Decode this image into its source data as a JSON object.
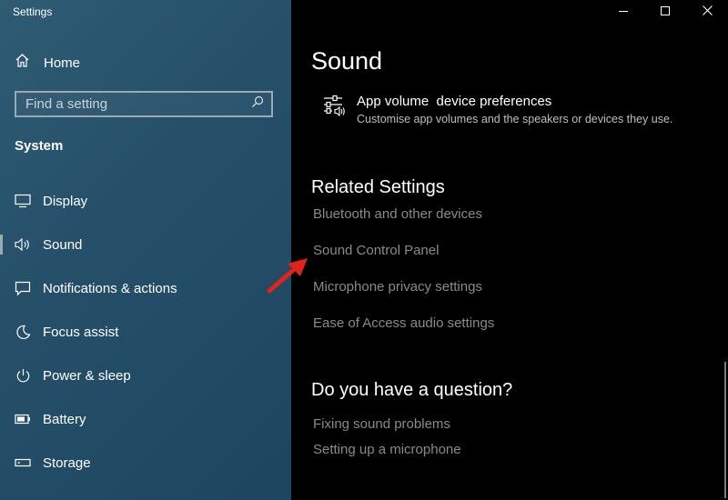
{
  "window": {
    "title": "Settings"
  },
  "sidebar": {
    "home_label": "Home",
    "search_placeholder": "Find a setting",
    "section_title": "System",
    "items": [
      {
        "label": "Display",
        "icon": "display-icon"
      },
      {
        "label": "Sound",
        "icon": "speaker-icon",
        "active": true
      },
      {
        "label": "Notifications & actions",
        "icon": "notification-icon"
      },
      {
        "label": "Focus assist",
        "icon": "moon-icon"
      },
      {
        "label": "Power & sleep",
        "icon": "power-icon"
      },
      {
        "label": "Battery",
        "icon": "battery-icon"
      },
      {
        "label": "Storage",
        "icon": "storage-icon"
      }
    ]
  },
  "main": {
    "title": "Sound",
    "app_volume": {
      "title": "App volume  device preferences",
      "description": "Customise app volumes and the speakers or devices they use.",
      "icon": "mixer-icon"
    },
    "related": {
      "heading": "Related Settings",
      "links": [
        "Bluetooth and other devices",
        "Sound Control Panel",
        "Microphone privacy settings",
        "Ease of Access audio settings"
      ]
    },
    "question": {
      "heading": "Do you have a question?",
      "links": [
        "Fixing sound problems",
        "Setting up a microphone"
      ]
    }
  },
  "colors": {
    "sidebar_bg": "#26506a",
    "main_bg": "#000000",
    "link_gray": "#8a8a8a",
    "arrow_red": "#e0241b"
  }
}
